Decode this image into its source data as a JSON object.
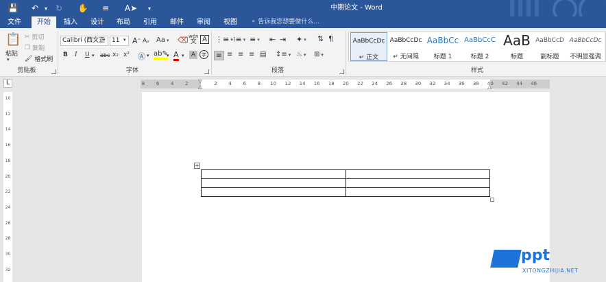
{
  "titlebar": {
    "title": "中期论文 - Word",
    "qa_icons": [
      "save-icon",
      "undo-icon",
      "redo-icon",
      "touch-mode-icon",
      "customize-icon",
      "format-painter-icon",
      "more-icon"
    ]
  },
  "tabs": [
    {
      "label": "文件",
      "active": false
    },
    {
      "label": "开始",
      "active": true
    },
    {
      "label": "插入",
      "active": false
    },
    {
      "label": "设计",
      "active": false
    },
    {
      "label": "布局",
      "active": false
    },
    {
      "label": "引用",
      "active": false
    },
    {
      "label": "邮件",
      "active": false
    },
    {
      "label": "审阅",
      "active": false
    },
    {
      "label": "视图",
      "active": false
    }
  ],
  "tell_me": {
    "placeholder": "告诉我您想要做什么..."
  },
  "clipboard": {
    "paste_label": "粘贴",
    "cut_label": "剪切",
    "copy_label": "复制",
    "format_painter_label": "格式刷",
    "group_label": "剪贴板"
  },
  "font": {
    "font_name": "Calibri (西文正",
    "font_size": "11",
    "aa_label": "Aa",
    "bold": "B",
    "italic": "I",
    "underline": "U",
    "strike": "abc",
    "subscript": "x₂",
    "superscript": "x²",
    "group_label": "字体",
    "wen": "wén",
    "wen_char": "文",
    "a_char": "A",
    "circled_char": "字"
  },
  "paragraph": {
    "group_label": "段落"
  },
  "styles": {
    "group_label": "样式",
    "items": [
      {
        "preview": "AaBbCcDc",
        "name": "↵ 正文",
        "selected": true
      },
      {
        "preview": "AaBbCcDc",
        "name": "↵ 无间隔",
        "selected": false
      },
      {
        "preview": "AaBbCc",
        "name": "标题 1",
        "selected": false
      },
      {
        "preview": "AaBbCcC",
        "name": "标题 2",
        "selected": false
      },
      {
        "preview": "AaB",
        "name": "标题",
        "selected": false
      },
      {
        "preview": "AaBbCcD",
        "name": "副标题",
        "selected": false
      },
      {
        "preview": "AaBbCcDc",
        "name": "不明显强调",
        "selected": false
      }
    ]
  },
  "ruler": {
    "h_ticks": [
      "8",
      "6",
      "4",
      "2",
      "",
      "2",
      "4",
      "6",
      "8",
      "10",
      "12",
      "14",
      "16",
      "18",
      "20",
      "22",
      "24",
      "26",
      "28",
      "30",
      "32",
      "34",
      "36",
      "38",
      "40",
      "42",
      "44",
      "46"
    ],
    "v_ticks": [
      "10",
      "12",
      "14",
      "16",
      "18",
      "20",
      "22",
      "24",
      "26",
      "28",
      "30",
      "32"
    ],
    "corner": "L"
  },
  "document": {
    "table": {
      "rows": 3,
      "cols": 2
    }
  },
  "watermark": {
    "brand": "ppt",
    "site": "XITONGZHIJIA.NET"
  }
}
